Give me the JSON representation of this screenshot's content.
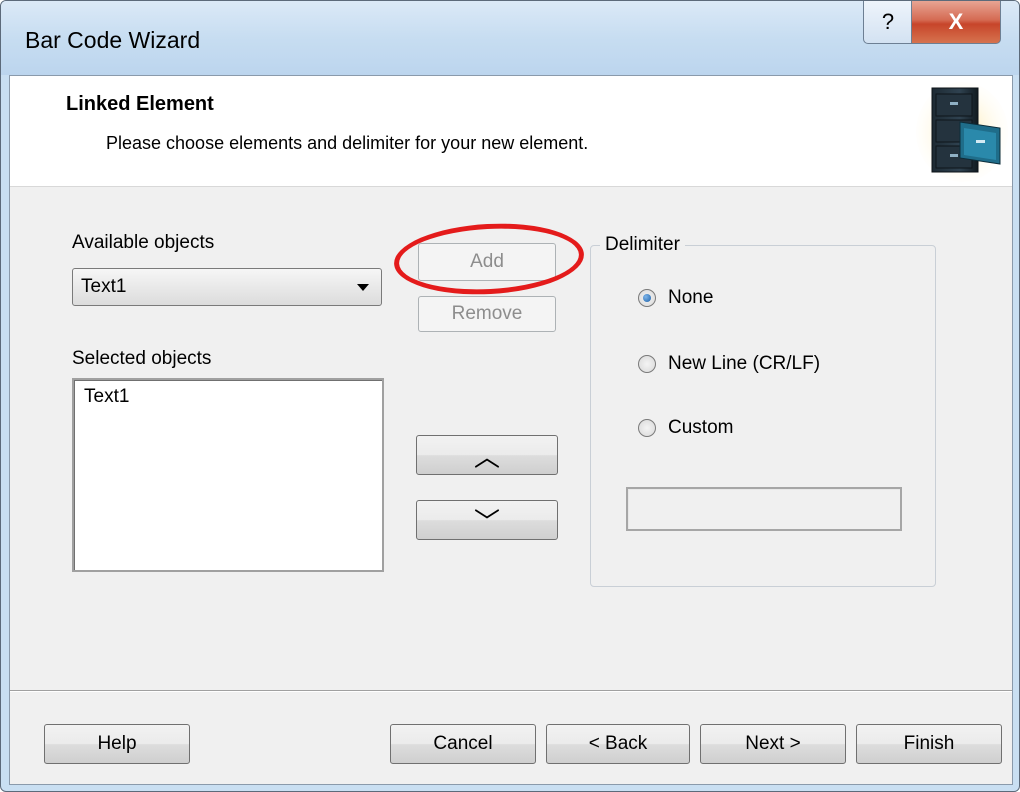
{
  "window": {
    "title": "Bar Code Wizard",
    "help_glyph": "?",
    "close_glyph": "X"
  },
  "header": {
    "title": "Linked Element",
    "subtitle": "Please choose elements and delimiter for your new element.",
    "icon": "file-cabinet-icon"
  },
  "available": {
    "label": "Available objects",
    "selected_value": "Text1"
  },
  "selected": {
    "label": "Selected objects",
    "items": [
      "Text1"
    ]
  },
  "buttons": {
    "add": "Add",
    "remove": "Remove",
    "up": "︿",
    "down": "﹀"
  },
  "delimiter": {
    "legend": "Delimiter",
    "options": [
      {
        "label": "None",
        "checked": true
      },
      {
        "label": "New Line (CR/LF)",
        "checked": false
      },
      {
        "label": "Custom",
        "checked": false
      }
    ],
    "custom_value": ""
  },
  "footer": {
    "help": "Help",
    "cancel": "Cancel",
    "back": "< Back",
    "next": "Next >",
    "finish": "Finish"
  },
  "colors": {
    "highlight_ring": "#e41b1b",
    "titlebar": "#c7ddf1",
    "close_button": "#c7452a"
  }
}
